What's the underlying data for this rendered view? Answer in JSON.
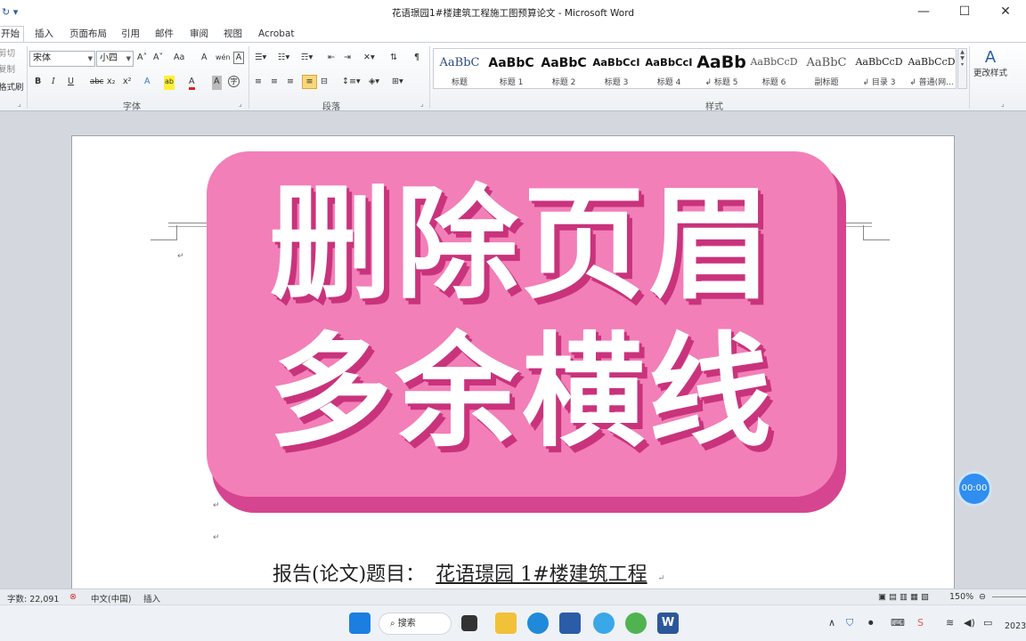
{
  "window": {
    "title": "花语璟园1#楼建筑工程施工图预算论文 - Microsoft Word",
    "qa_icons": "↻ ▾"
  },
  "tabs": [
    "开始",
    "插入",
    "页面布局",
    "引用",
    "邮件",
    "审阅",
    "视图",
    "Acrobat"
  ],
  "ribbon": {
    "clipboard": {
      "cut": "剪切",
      "copy": "复制",
      "painter": "格式刷"
    },
    "font": {
      "label": "字体",
      "name": "宋体",
      "size": "小四",
      "grow": "A˄",
      "shrink": "A˅",
      "case": "Aa",
      "clear": "A",
      "pinyin": "wén",
      "border_char": "A",
      "bold": "B",
      "italic": "I",
      "underline": "U",
      "strike": "abc",
      "sub": "x₂",
      "sup": "x²",
      "effects": "A",
      "highlight": "ab",
      "color": "A",
      "shading": "A",
      "enclose": "字"
    },
    "paragraph": {
      "label": "段落"
    },
    "styles": {
      "label": "样式",
      "items": [
        {
          "sample": "AaBbC",
          "name": "标题"
        },
        {
          "sample": "AaBbC",
          "name": "标题 1"
        },
        {
          "sample": "AaBbC",
          "name": "标题 2"
        },
        {
          "sample": "AaBbCcI",
          "name": "标题 3"
        },
        {
          "sample": "AaBbCcI",
          "name": "标题 4"
        },
        {
          "sample": "AaBb",
          "name": "↲ 标题 5"
        },
        {
          "sample": "AaBbCcD",
          "name": "标题 6"
        },
        {
          "sample": "AaBbC",
          "name": "副标题"
        },
        {
          "sample": "AaBbCcD",
          "name": "↲ 目录 3"
        },
        {
          "sample": "AaBbCcD",
          "name": "↲ 普通(网..."
        }
      ],
      "change_styles": "更改样式"
    }
  },
  "document": {
    "report_prefix": "报告(论文)题目：",
    "report_title": "花语璟园 1#楼建筑工程",
    "para_mark": "↵"
  },
  "overlay": {
    "line1": "删除页眉",
    "line2": "多余横线",
    "bg": "#f27fb8",
    "shadow": "#d6458f"
  },
  "timer": "00:00",
  "status": {
    "wordcount": "字数: 22,091",
    "language": "中文(中国)",
    "mode": "插入",
    "zoom": "150%"
  },
  "taskbar": {
    "search": "搜索",
    "year": "2023"
  }
}
